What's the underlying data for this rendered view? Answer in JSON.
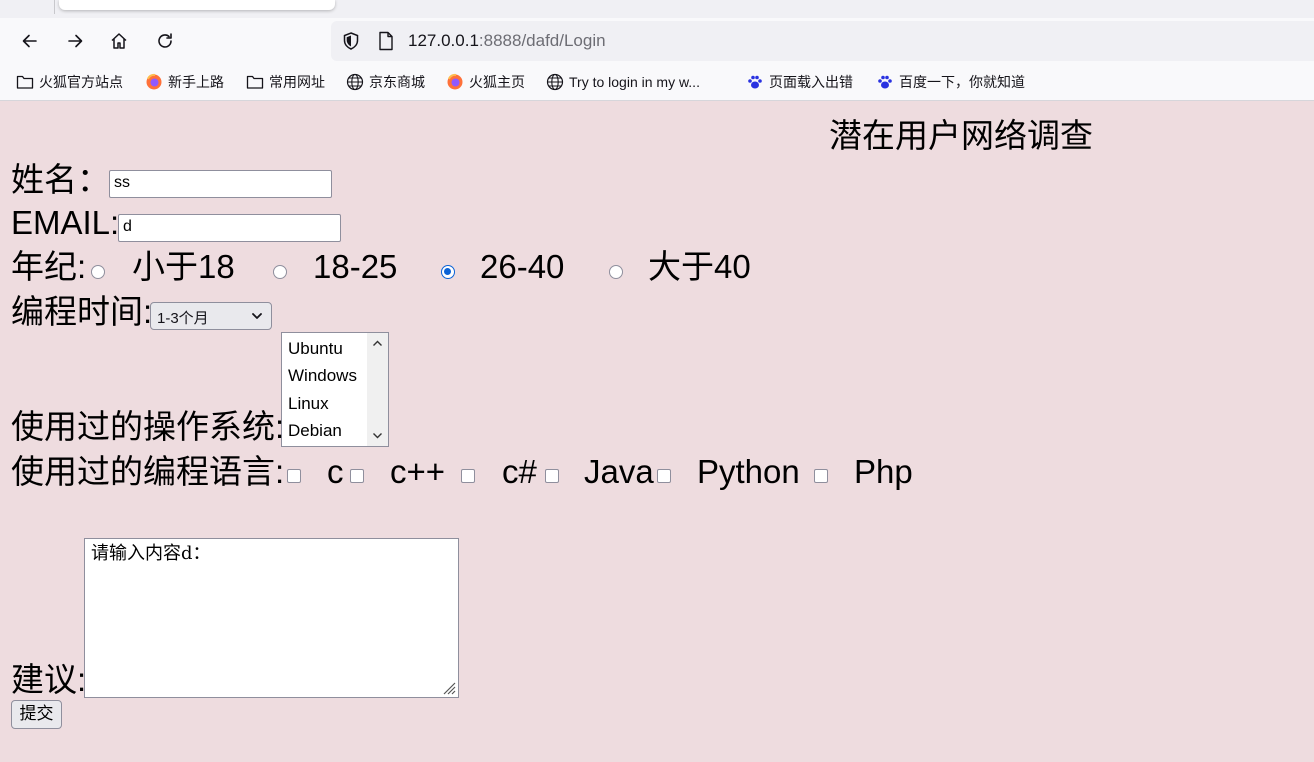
{
  "browser": {
    "url_host": "127.0.0.1",
    "url_rest": ":8888/dafd/Login",
    "bookmarks": [
      {
        "label": "火狐官方站点",
        "icon": "folder-icon"
      },
      {
        "label": "新手上路",
        "icon": "firefox-icon"
      },
      {
        "label": "常用网址",
        "icon": "folder-icon"
      },
      {
        "label": "京东商城",
        "icon": "globe-icon"
      },
      {
        "label": "火狐主页",
        "icon": "firefox-icon"
      },
      {
        "label": "Try to login in my w...",
        "icon": "globe-icon"
      },
      {
        "label": "页面载入出错",
        "icon": "baidu-paw-icon"
      },
      {
        "label": "百度一下，你就知道",
        "icon": "baidu-paw-icon"
      }
    ]
  },
  "form": {
    "title": "潜在用户网络调查",
    "name_label": "姓名：",
    "name_value": "ss",
    "email_label": "EMAIL:",
    "email_value": "d",
    "age_label": "年纪:",
    "age_options": [
      "小于18",
      "18-25",
      "26-40",
      "大于40"
    ],
    "age_selected": "26-40",
    "time_label": "编程时间:",
    "time_selected": "1-3个月",
    "os_label": "使用过的操作系统:",
    "os_options": [
      "Ubuntu",
      "Windows",
      "Linux",
      "Debian"
    ],
    "lang_label": "使用过的编程语言:",
    "lang_options": [
      "c",
      "c++",
      "c#",
      "Java",
      "Python",
      "Php"
    ],
    "advice_label": "建议:",
    "advice_value": "请输入内容d：",
    "submit_label": "提交"
  },
  "colors": {
    "page_bg": "#eedcdf",
    "radio_checked": "#0b63d6"
  }
}
